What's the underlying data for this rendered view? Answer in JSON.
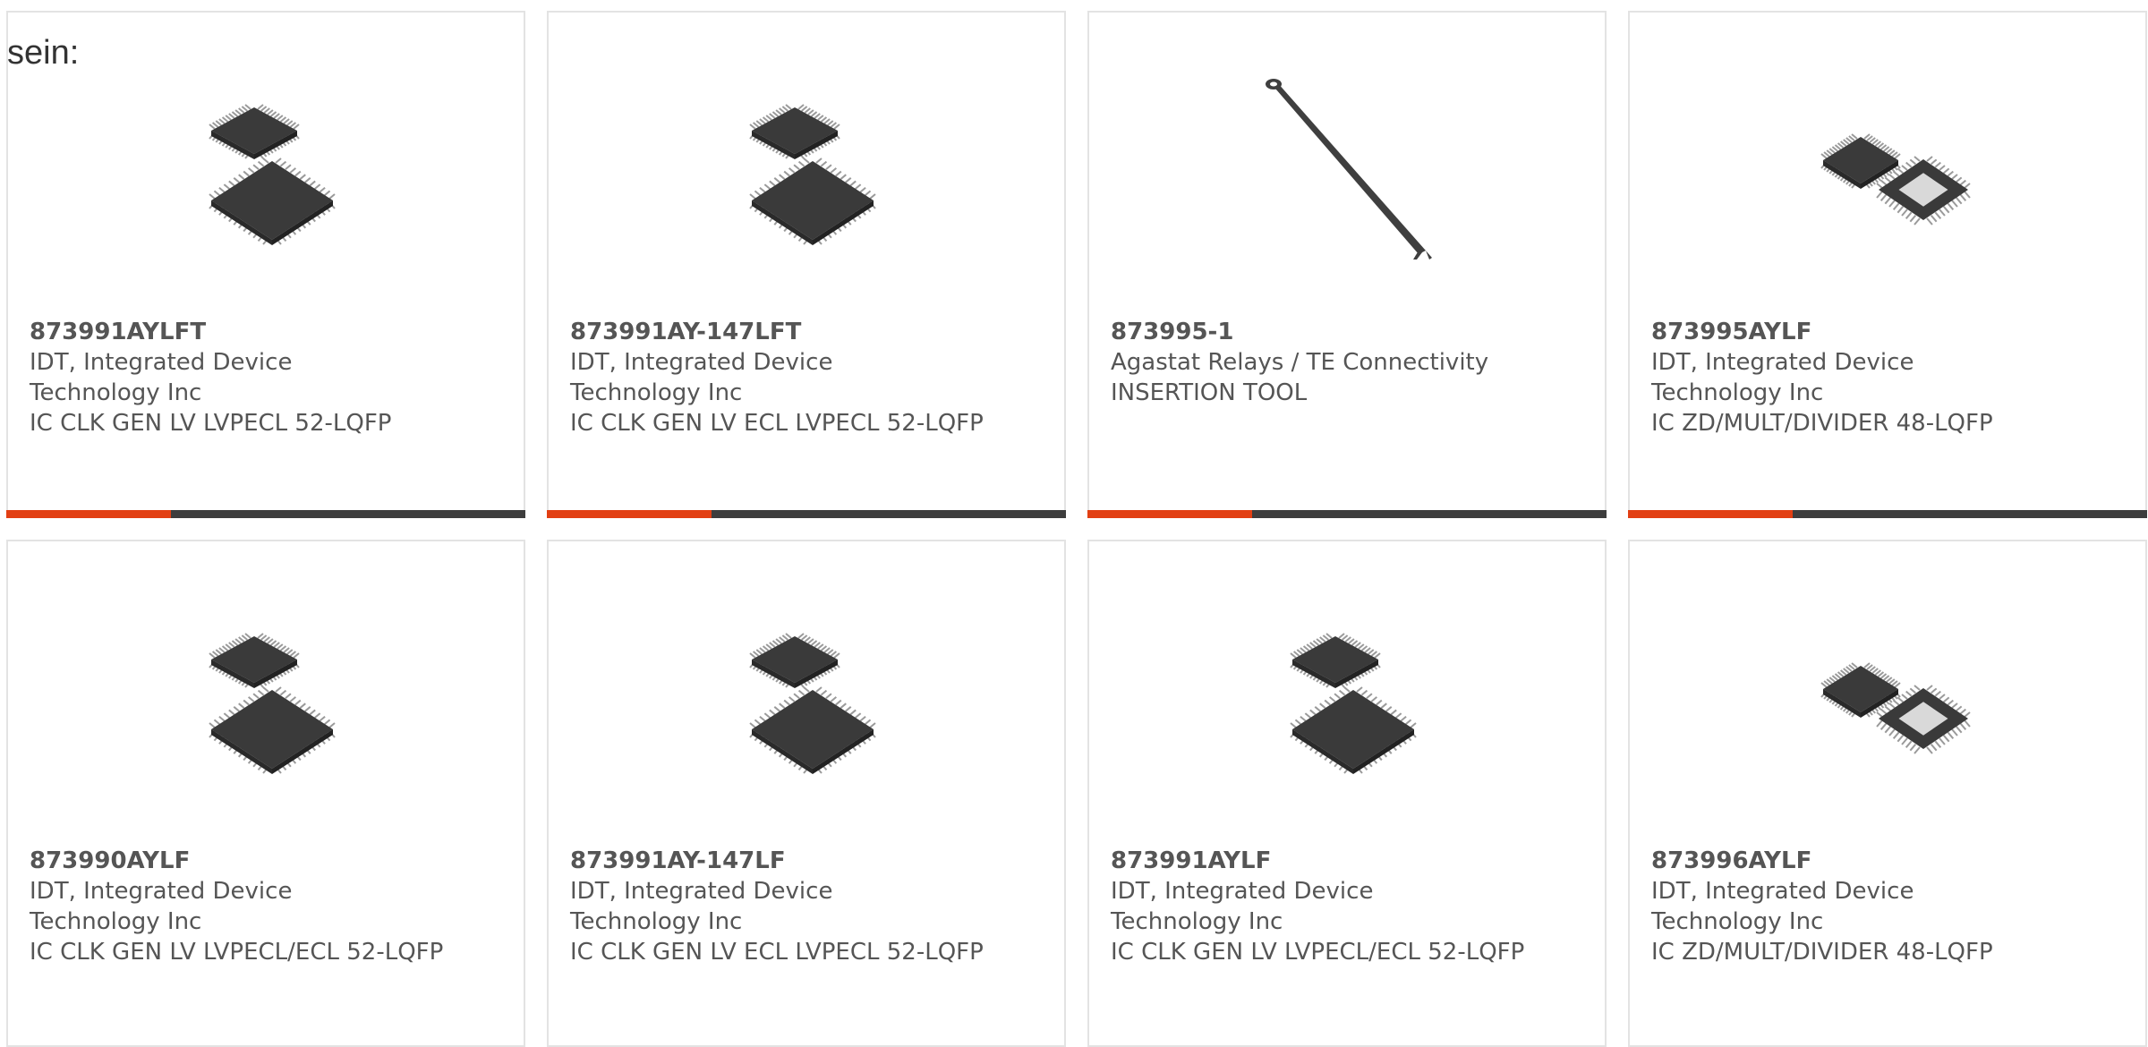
{
  "page": {
    "heading": "sein:"
  },
  "colors": {
    "accent": "#e23f13",
    "bar": "#3d3d3d",
    "text": "#555555",
    "border": "#e3e3e3"
  },
  "products": [
    {
      "part_number": "873991AYLFT",
      "manufacturer_line1": "IDT, Integrated Device",
      "manufacturer_line2": "Technology Inc",
      "description": "IC CLK GEN LV LVPECL 52-LQFP",
      "image": "lqfp-chip-pair"
    },
    {
      "part_number": "873991AY-147LFT",
      "manufacturer_line1": "IDT, Integrated Device",
      "manufacturer_line2": "Technology Inc",
      "description": "IC CLK GEN LV ECL LVPECL 52-LQFP",
      "image": "lqfp-chip-pair"
    },
    {
      "part_number": "873995-1",
      "manufacturer_line1": "Agastat Relays / TE Connectivity",
      "manufacturer_line2": "",
      "description": "INSERTION TOOL",
      "image": "insertion-tool"
    },
    {
      "part_number": "873995AYLF",
      "manufacturer_line1": "IDT, Integrated Device",
      "manufacturer_line2": "Technology Inc",
      "description": "IC ZD/MULT/DIVIDER 48-LQFP",
      "image": "lqfp-chip-side-by-side"
    },
    {
      "part_number": "873990AYLF",
      "manufacturer_line1": "IDT, Integrated Device",
      "manufacturer_line2": "Technology Inc",
      "description": "IC CLK GEN LV LVPECL/ECL 52-LQFP",
      "image": "lqfp-chip-pair"
    },
    {
      "part_number": "873991AY-147LF",
      "manufacturer_line1": "IDT, Integrated Device",
      "manufacturer_line2": "Technology Inc",
      "description": "IC CLK GEN LV ECL LVPECL 52-LQFP",
      "image": "lqfp-chip-pair"
    },
    {
      "part_number": "873991AYLF",
      "manufacturer_line1": "IDT, Integrated Device",
      "manufacturer_line2": "Technology Inc",
      "description": "IC CLK GEN LV LVPECL/ECL 52-LQFP",
      "image": "lqfp-chip-pair"
    },
    {
      "part_number": "873996AYLF",
      "manufacturer_line1": "IDT, Integrated Device",
      "manufacturer_line2": "Technology Inc",
      "description": "IC ZD/MULT/DIVIDER 48-LQFP",
      "image": "lqfp-chip-side-by-side"
    }
  ]
}
